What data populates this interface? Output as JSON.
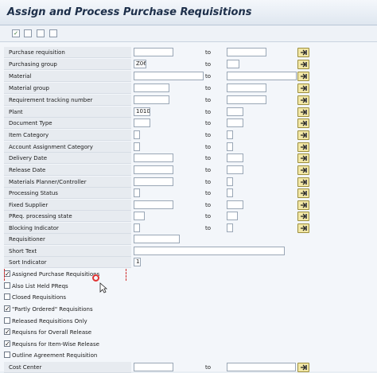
{
  "title": "Assign and Process Purchase Requisitions",
  "toolbar": {
    "icons": [
      "execute-icon",
      "copy-icon",
      "list-icon",
      "selection-icon"
    ]
  },
  "colors": {
    "multi_button": "#f2e7a6",
    "title_text": "#1d2f4a"
  },
  "to_label": "to",
  "criteria": [
    {
      "label": "Purchase requisition",
      "from": "",
      "to": ""
    },
    {
      "label": "Purchasing group",
      "from": "Z06",
      "to": ""
    },
    {
      "label": "Material",
      "from": "",
      "to": ""
    },
    {
      "label": "Material group",
      "from": "",
      "to": ""
    },
    {
      "label": "Requirement tracking number",
      "from": "",
      "to": ""
    },
    {
      "label": "Plant",
      "from": "1010",
      "to": ""
    },
    {
      "label": "Document Type",
      "from": "",
      "to": ""
    },
    {
      "label": "Item Category",
      "from": "",
      "to": ""
    },
    {
      "label": "Account Assignment Category",
      "from": "",
      "to": ""
    },
    {
      "label": "Delivery Date",
      "from": "",
      "to": ""
    },
    {
      "label": "Release Date",
      "from": "",
      "to": ""
    },
    {
      "label": "Materials Planner/Controller",
      "from": "",
      "to": ""
    },
    {
      "label": "Processing Status",
      "from": "",
      "to": ""
    },
    {
      "label": "Fixed Supplier",
      "from": "",
      "to": ""
    },
    {
      "label": "PReq. processing state",
      "from": "",
      "to": ""
    },
    {
      "label": "Blocking Indicator",
      "from": "",
      "to": ""
    }
  ],
  "single_fields": [
    {
      "label": "Requisitioner",
      "value": ""
    },
    {
      "label": "Short Text",
      "value": ""
    },
    {
      "label": "Sort Indicator",
      "value": "1"
    }
  ],
  "checkboxes": [
    {
      "label": "Assigned Purchase Requisitions",
      "checked": true
    },
    {
      "label": "Also List Held PReqs",
      "checked": false
    },
    {
      "label": "Closed Requisitions",
      "checked": false
    },
    {
      "label": "\"Partly Ordered\" Requisitions",
      "checked": true
    },
    {
      "label": "Released Requisitions Only",
      "checked": false
    },
    {
      "label": "Requisns for Overall Release",
      "checked": true
    },
    {
      "label": "Requisns for Item-Wise Release",
      "checked": true
    },
    {
      "label": "Outline Agreement Requisition",
      "checked": false
    }
  ],
  "cost_center": {
    "label": "Cost Center",
    "from": "",
    "to": ""
  }
}
